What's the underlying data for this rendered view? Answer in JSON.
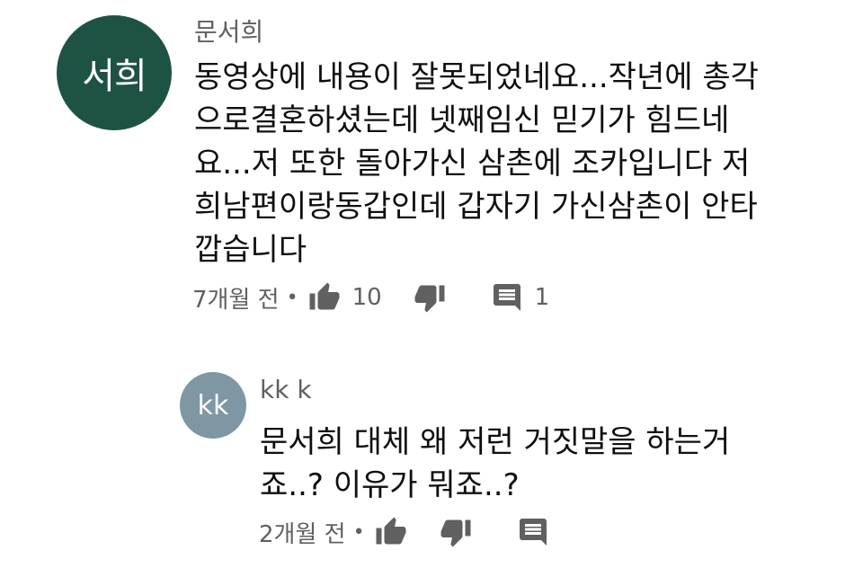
{
  "comments": [
    {
      "author": "문서희",
      "avatar": {
        "initials": "서희",
        "color": "#1e5245"
      },
      "lines": [
        "동영상에 내용이 잘못되었네요...작년에 총각",
        "으로결혼하셨는데 넷째임신 믿기가 힘드네",
        "요...저 또한 돌아가신 삼촌에 조카입니다 저",
        "희남편이랑동갑인데 갑자기 가신삼촌이 안타",
        "깝습니다"
      ],
      "time": "7개월 전",
      "dot": "•",
      "likes": "10",
      "replies": "1"
    },
    {
      "author": "kk k",
      "avatar": {
        "initials": "kk",
        "color": "#7e97a3"
      },
      "lines": [
        "문서희 대체 왜 저런 거짓말을 하는거",
        "죠..? 이유가 뭐죠..?"
      ],
      "time": "2개월 전",
      "dot": "•"
    }
  ],
  "icons": {
    "like": "thumb-up-icon",
    "dislike": "thumb-down-icon",
    "reply": "comment-icon"
  }
}
